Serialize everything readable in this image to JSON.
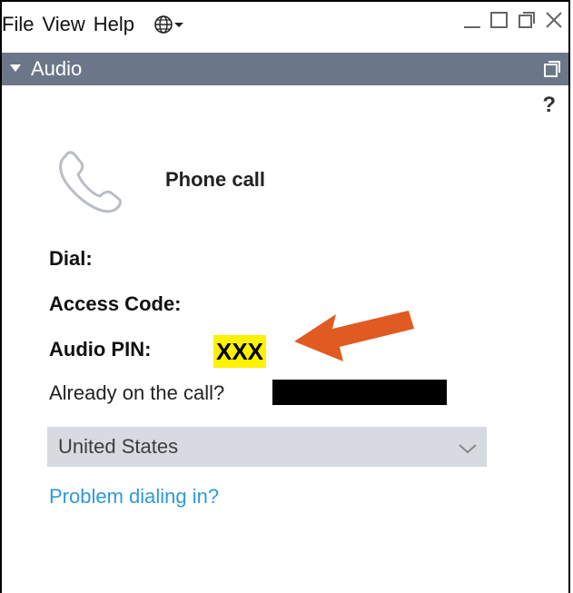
{
  "menu": {
    "items": [
      "File",
      "View",
      "Help"
    ],
    "language_icon": "globe-icon"
  },
  "window_controls": [
    "minimize-icon",
    "maximize-icon",
    "restore-icon",
    "close-icon"
  ],
  "audio_panel": {
    "title": "Audio",
    "help": "?",
    "phone_call_title": "Phone call",
    "dial_label": "Dial:",
    "access_code_label": "Access Code:",
    "audio_pin_label": "Audio PIN:",
    "audio_pin_value": "XXX",
    "already_on_call_label": "Already on the call?",
    "country_select": "United States",
    "problem_link": "Problem dialing in?"
  },
  "colors": {
    "header_bg": "#6b7789",
    "pin_highlight": "#fff200",
    "arrow": "#e15a22",
    "link": "#2f9ad6",
    "select_bg": "#d7dbe1"
  }
}
